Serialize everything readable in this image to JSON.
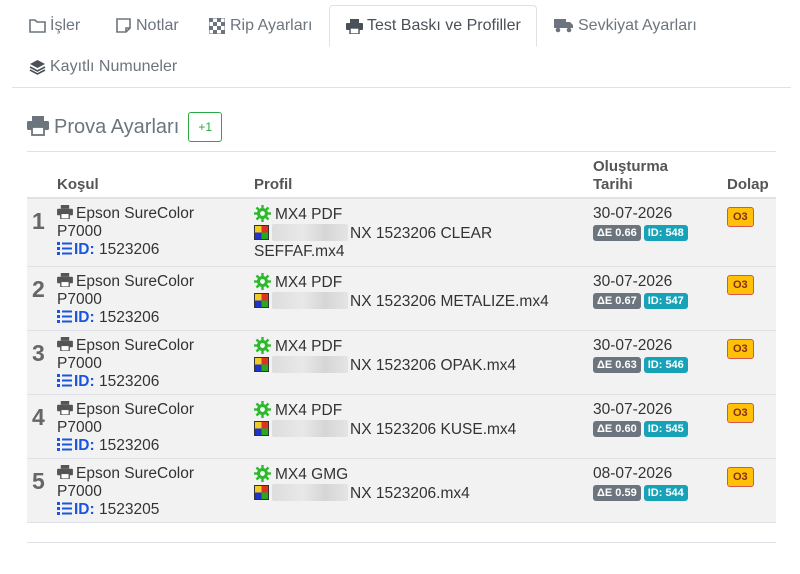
{
  "tabs": [
    {
      "label": "İşler",
      "icon": "folder-icon"
    },
    {
      "label": "Notlar",
      "icon": "note-icon"
    },
    {
      "label": "Rip Ayarları",
      "icon": "checkerboard-icon"
    },
    {
      "label": "Test Baskı ve Profiller",
      "icon": "printer-icon",
      "active": true
    },
    {
      "label": "Sevkiyat Ayarları",
      "icon": "truck-icon"
    },
    {
      "label": "Kayıtlı Numuneler",
      "icon": "layers-icon"
    }
  ],
  "section": {
    "title": "Prova Ayarları",
    "plus_label": "+1"
  },
  "table": {
    "headers": {
      "kosul": "Koşul",
      "profil": "Profil",
      "tarih": "Oluşturma Tarihi",
      "dolap": "Dolap"
    },
    "rows": [
      {
        "index": "1",
        "printer": "Epson SureColor P7000",
        "id_label": "ID:",
        "id_value": "1523206",
        "profile_type": "MX4 PDF",
        "profile_file": "NX 1523206 CLEAR SEFFAF.mx4",
        "date": "30-07-2026",
        "delta_e": "ΔE 0.66",
        "id_badge": "ID: 548",
        "dolap": "O3"
      },
      {
        "index": "2",
        "printer": "Epson SureColor P7000",
        "id_label": "ID:",
        "id_value": "1523206",
        "profile_type": "MX4 PDF",
        "profile_file": "NX 1523206 METALIZE.mx4",
        "date": "30-07-2026",
        "delta_e": "ΔE 0.67",
        "id_badge": "ID: 547",
        "dolap": "O3"
      },
      {
        "index": "3",
        "printer": "Epson SureColor P7000",
        "id_label": "ID:",
        "id_value": "1523206",
        "profile_type": "MX4 PDF",
        "profile_file": "NX 1523206 OPAK.mx4",
        "date": "30-07-2026",
        "delta_e": "ΔE 0.63",
        "id_badge": "ID: 546",
        "dolap": "O3"
      },
      {
        "index": "4",
        "printer": "Epson SureColor P7000",
        "id_label": "ID:",
        "id_value": "1523206",
        "profile_type": "MX4 PDF",
        "profile_file": "NX 1523206 KUSE.mx4",
        "date": "30-07-2026",
        "delta_e": "ΔE 0.60",
        "id_badge": "ID: 545",
        "dolap": "O3"
      },
      {
        "index": "5",
        "printer": "Epson SureColor P7000",
        "id_label": "ID:",
        "id_value": "1523205",
        "profile_type": "MX4 GMG",
        "profile_file": "NX 1523206.mx4",
        "date": "08-07-2026",
        "delta_e": "ΔE 0.59",
        "id_badge": "ID: 544",
        "dolap": "O3"
      }
    ]
  },
  "colors": {
    "accent_green": "#28a745",
    "id_blue": "#1a56db",
    "badge_gray": "#6c757d",
    "badge_teal": "#17a2b8",
    "dolap_yellow": "#ffc107"
  }
}
